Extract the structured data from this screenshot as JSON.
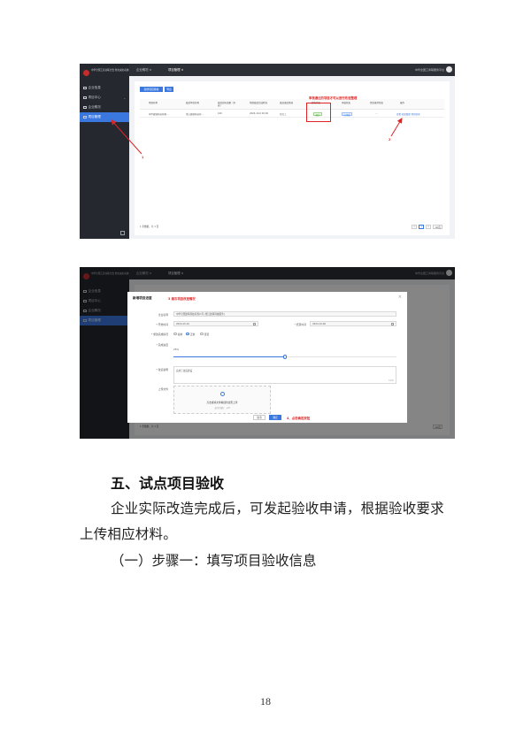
{
  "shot1": {
    "logo_text": "中华全国工商业联合会 防灾减灾系统平台",
    "nav": [
      {
        "label": "企业信息"
      },
      {
        "label": "项目中心"
      },
      {
        "label": "企业概况"
      },
      {
        "label": "项目管理"
      }
    ],
    "tabs": [
      {
        "label": "企业概况 ×"
      },
      {
        "label": "项目管理 ×"
      }
    ],
    "top_right": "中华全国工商联服务平台",
    "buttons": {
      "new": "新增项目验收",
      "export": "导出"
    },
    "columns": [
      "项目名称",
      "改造单位名称",
      "改造实际金额（万元）",
      "项目改造完成时间",
      "改造进度情况",
      "验收状态",
      "审核状态",
      "资金拨付状态",
      "操作"
    ],
    "row": {
      "name": "中华建筑科技有限...",
      "unit": "浙江建筑科技有...",
      "amount": "100",
      "time": "2024-10-0 0X:00",
      "progress": "已完工",
      "accept": "通过",
      "audit": "已审批",
      "fund": "...",
      "ops": "查看  修改整理  项目验收"
    },
    "annotation_top": "审核通过的项目才可以进行改造整理",
    "annotation_1": "1",
    "annotation_2": "2",
    "pager_left": "1 条数据，共 1 页",
    "pager_pages": [
      "<",
      "1",
      ">"
    ],
    "pager_size": "10/页"
  },
  "shot2": {
    "modal_title": "新增项目进度",
    "annotation_3": "3  填写项目改造情况",
    "fields": {
      "company_label": "企业名称",
      "company_value": "中华全国建筑科技有限公司 (浙江建筑科技服务)",
      "start_label": "* 开始时间",
      "start_value": "2024-10-10",
      "end_label": "* 结束时间",
      "end_value": "2024-10-26",
      "status_label": "* 整改完成情况",
      "status_options": [
        "提前",
        "正常",
        "延迟"
      ],
      "status_selected": 1,
      "progress_label": "* 完成进度",
      "progress_value": "25%",
      "progress_fraction": 0.5,
      "desc_label": "* 改造说明",
      "desc_value": "完成了改造建设",
      "desc_counter": "7/200",
      "file_label": "上传文件",
      "upload_text": "点击或将文件拖拽到这里上传",
      "upload_hint": "支持扩展名：.pdf"
    },
    "cancel": "取消",
    "confirm": "确定",
    "annotation_4": "4、点击确定按钮",
    "pager_left": "1 条数据，共 1 页",
    "pager_size": "10/页"
  },
  "text": {
    "section_title": "五、试点项目验收",
    "para_line1": "企业实际改造完成后，可发起验收申请，根据验收要求",
    "para_line2": "上传相应材料。",
    "step1": "（一）步骤一：填写项目验收信息",
    "page_number": "18"
  },
  "colors": {
    "sidebar": "#26282f",
    "accent": "#3a78e0",
    "annotation": "#e02424"
  }
}
